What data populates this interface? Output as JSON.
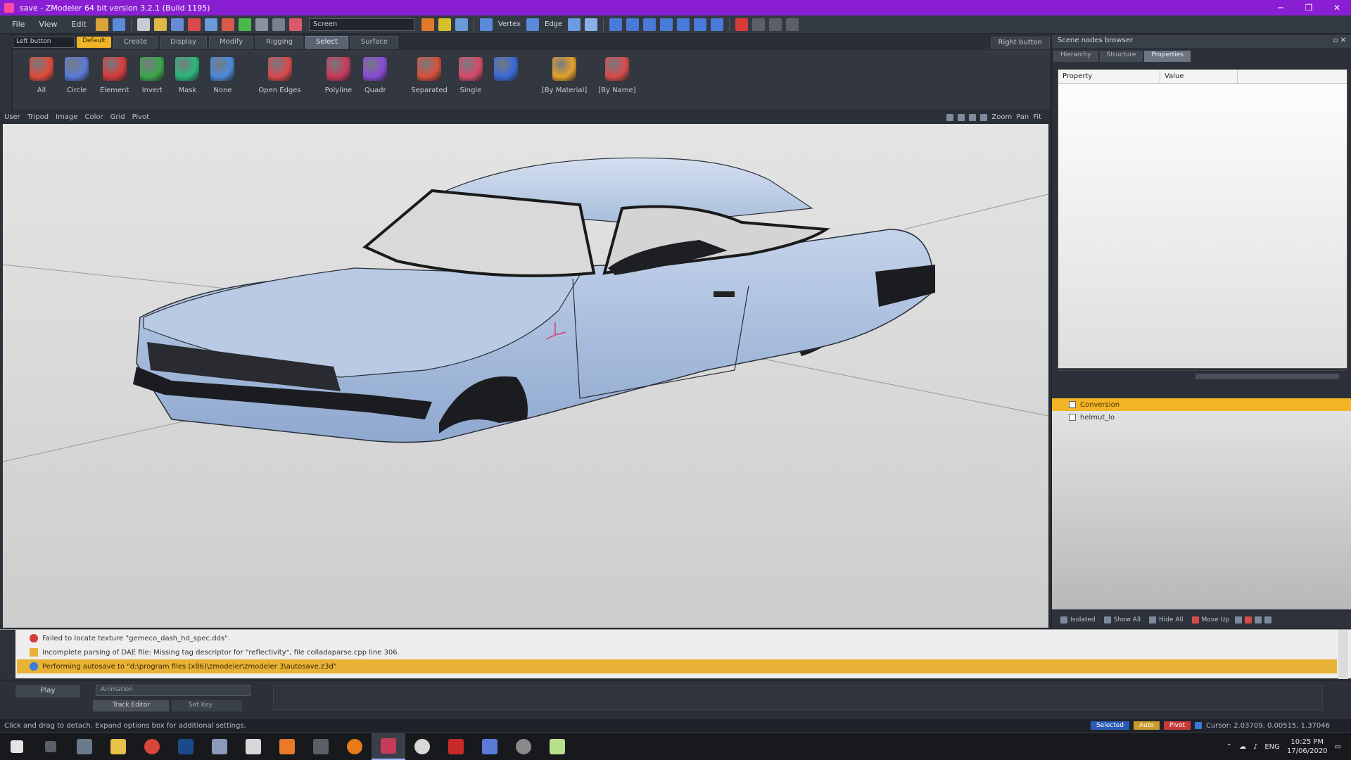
{
  "titlebar": {
    "title": "save - ZModeler 64 bit version 3.2.1 (Build 1195)",
    "minimize": "─",
    "maximize": "❐",
    "close": "✕"
  },
  "menu": {
    "items": [
      "File",
      "View",
      "Edit"
    ]
  },
  "toolbar": {
    "view_combo": "Screen",
    "vertex_label": "Vertex",
    "edge_label": "Edge"
  },
  "ribbon": {
    "left_button_combo": "Left button",
    "default_btn": "Default",
    "tabs": [
      "Create",
      "Display",
      "Modify",
      "Rigging",
      "Select",
      "Surface"
    ],
    "active_tab": "Select",
    "right_button_label": "Right button",
    "buttons": [
      {
        "label": "All",
        "color": "#e04a3a"
      },
      {
        "label": "Circle",
        "color": "#5a7ad8"
      },
      {
        "label": "Element",
        "color": "#d83a3a"
      },
      {
        "label": "Invert",
        "color": "#3aa84a"
      },
      {
        "label": "Mask",
        "color": "#2bb87a"
      },
      {
        "label": "None",
        "color": "#4a8ad8"
      },
      {
        "label": "Open Edges",
        "color": "#d84a4a"
      },
      {
        "label": "Polyline",
        "color": "#c83a5a"
      },
      {
        "label": "Quadr",
        "color": "#8a4ad8"
      },
      {
        "label": "Separated",
        "color": "#d8503a"
      },
      {
        "label": "Single",
        "color": "#d84a6a"
      },
      {
        "label": "",
        "color": "#3a6ad8"
      },
      {
        "label": "[By Material]",
        "color": "#e4a02a"
      },
      {
        "label": "[By Name]",
        "color": "#d84a4a"
      }
    ]
  },
  "viewport_header": {
    "items": [
      "User",
      "Tripod",
      "Image",
      "Color",
      "Grid",
      "Pivot"
    ],
    "right_items": [
      "Zoom",
      "Pan",
      "Fit"
    ]
  },
  "scene_nodes_browser": {
    "title": "Scene nodes browser",
    "tabs": [
      "Hierarchy",
      "Structure",
      "Properties"
    ],
    "active_tab": "Properties",
    "prop_headers": [
      "Property",
      "Value"
    ],
    "tree": [
      {
        "label": "Conversion",
        "selected": true
      },
      {
        "label": "helmut_lo",
        "selected": false
      }
    ],
    "footer": [
      "Isolated",
      "Show All",
      "Hide All",
      "Move Up"
    ]
  },
  "log": {
    "rows": [
      {
        "type": "error",
        "text": "Failed to locate texture \"gemeco_dash_hd_spec.dds\"."
      },
      {
        "type": "warning",
        "text": "Incomplete parsing of DAE file: Missing tag descriptor for \"reflectivity\", file colladaparse.cpp line 306."
      },
      {
        "type": "info",
        "text": "Performing autosave to \"d:\\program files (x86)\\zmodeler\\zmodeler 3\\autosave.z3d\""
      }
    ]
  },
  "animation": {
    "play_label": "Play",
    "combo": "Animation",
    "track_editor": "Track Editor",
    "set_key": "Set Key"
  },
  "status": {
    "hint": "Click and drag to detach. Expand options box for additional settings.",
    "selected": "Selected",
    "auto": "Auto",
    "pivot": "Pivot",
    "cursor": "Cursor: 2.03709, 0.00515, 1.37046"
  },
  "taskbar": {
    "lang": "ENG",
    "time": "10:25 PM",
    "date": "17/06/2020"
  },
  "colors": {
    "accent_yellow": "#f3b526",
    "titlebar_purple": "#8a1ed2",
    "car_body": "#a9bfdc"
  }
}
